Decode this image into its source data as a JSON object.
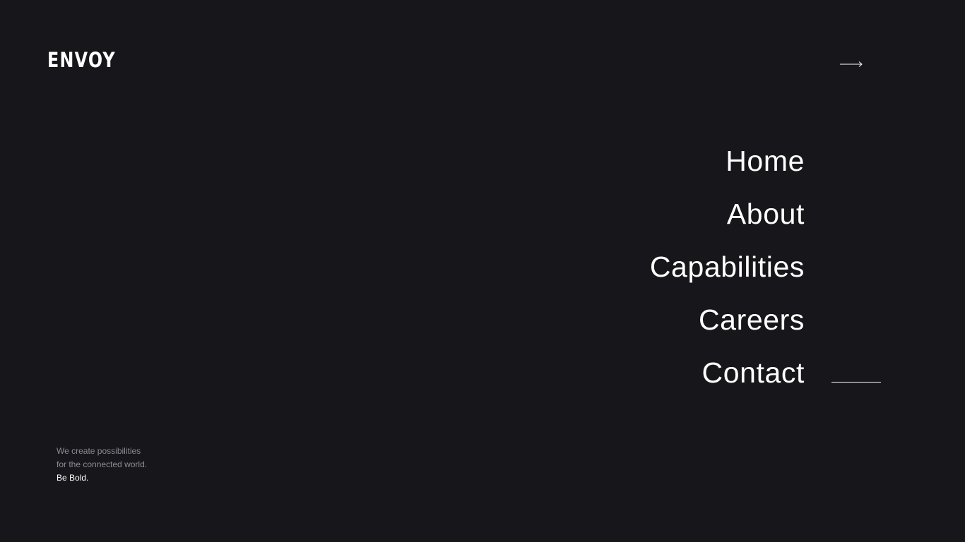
{
  "brand": {
    "logo_text": "ENVOY"
  },
  "header": {
    "arrow_icon": "arrow-right-icon"
  },
  "nav": {
    "items": [
      {
        "label": "Home"
      },
      {
        "label": "About"
      },
      {
        "label": "Capabilities"
      },
      {
        "label": "Careers"
      },
      {
        "label": "Contact"
      }
    ],
    "active_item": "Contact"
  },
  "tagline": {
    "line1": "We create possibilities",
    "line2": "for the connected world.",
    "line3": "Be Bold."
  },
  "colors": {
    "background": "#17161b",
    "text": "#ffffff",
    "muted_text": "#8d8c92"
  }
}
